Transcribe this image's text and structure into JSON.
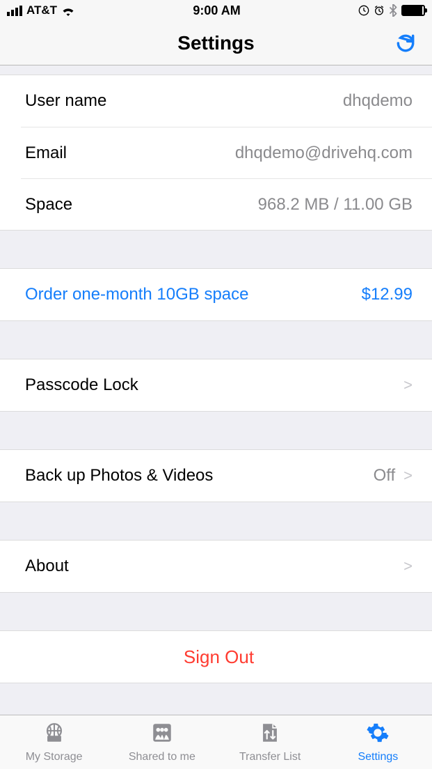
{
  "statusbar": {
    "carrier": "AT&T",
    "time": "9:00 AM"
  },
  "header": {
    "title": "Settings"
  },
  "account": {
    "username_label": "User name",
    "username_value": "dhqdemo",
    "email_label": "Email",
    "email_value": "dhqdemo@drivehq.com",
    "space_label": "Space",
    "space_value": "968.2 MB / 11.00 GB"
  },
  "order": {
    "label": "Order one-month 10GB space",
    "price": "$12.99"
  },
  "passcode": {
    "label": "Passcode Lock"
  },
  "backup": {
    "label": "Back up Photos & Videos",
    "value": "Off"
  },
  "about": {
    "label": "About"
  },
  "signout": {
    "label": "Sign Out"
  },
  "tabs": {
    "my_storage": "My Storage",
    "shared": "Shared to me",
    "transfer": "Transfer List",
    "settings": "Settings"
  }
}
